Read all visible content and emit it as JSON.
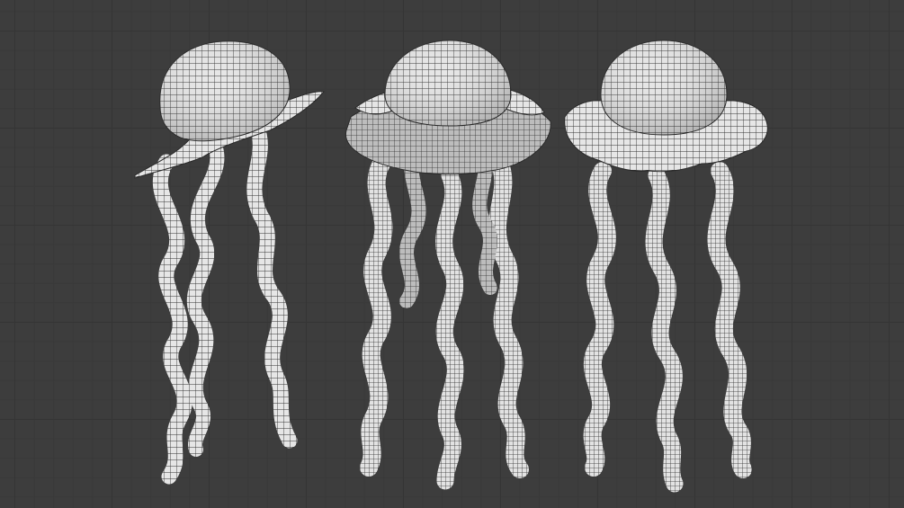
{
  "viewport": {
    "background": "#3d3d3d",
    "grid_major": "#353535",
    "grid_minor": "#393939"
  },
  "mesh": {
    "surface": "#e9e9e9",
    "shade": "#bdbdbd",
    "wire": "#2a2a2a"
  },
  "models": [
    {
      "name": "jellyfish-side-view",
      "view": "side"
    },
    {
      "name": "jellyfish-three-quarter-view",
      "view": "three-quarter"
    },
    {
      "name": "jellyfish-front-view",
      "view": "front"
    }
  ]
}
